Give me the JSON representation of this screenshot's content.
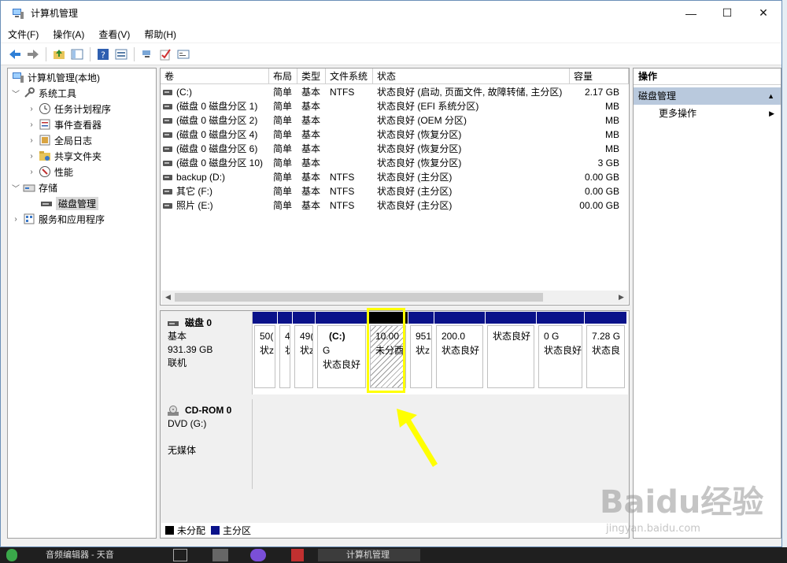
{
  "window": {
    "title": "计算机管理",
    "minimize": "—",
    "maximize": "☐",
    "close": "✕"
  },
  "menu": [
    "文件(F)",
    "操作(A)",
    "查看(V)",
    "帮助(H)"
  ],
  "tree": {
    "root": "计算机管理(本地)",
    "system_tools": "系统工具",
    "task_scheduler": "任务计划程序",
    "event_viewer": "事件查看器",
    "shared_folders_log": "全局日志",
    "shared_folders": "共享文件夹",
    "performance": "性能",
    "storage": "存储",
    "disk_management": "磁盘管理",
    "services": "服务和应用程序"
  },
  "volumes": {
    "headers": [
      "卷",
      "布局",
      "类型",
      "文件系统",
      "状态",
      "容量"
    ],
    "rows": [
      [
        "(C:)",
        "简单",
        "基本",
        "NTFS",
        "状态良好 (启动, 页面文件, 故障转储, 主分区)",
        "2.17 GB"
      ],
      [
        "(磁盘 0 磁盘分区 1)",
        "简单",
        "基本",
        "",
        "状态良好 (EFI 系统分区)",
        "MB"
      ],
      [
        "(磁盘 0 磁盘分区 2)",
        "简单",
        "基本",
        "",
        "状态良好 (OEM 分区)",
        "MB"
      ],
      [
        "(磁盘 0 磁盘分区 4)",
        "简单",
        "基本",
        "",
        "状态良好 (恢复分区)",
        "MB"
      ],
      [
        "(磁盘 0 磁盘分区 6)",
        "简单",
        "基本",
        "",
        "状态良好 (恢复分区)",
        "MB"
      ],
      [
        "(磁盘 0 磁盘分区 10)",
        "简单",
        "基本",
        "",
        "状态良好 (恢复分区)",
        "3 GB"
      ],
      [
        "backup (D:)",
        "简单",
        "基本",
        "NTFS",
        "状态良好 (主分区)",
        "0.00 GB"
      ],
      [
        "其它 (F:)",
        "简单",
        "基本",
        "NTFS",
        "状态良好 (主分区)",
        "0.00 GB"
      ],
      [
        "照片 (E:)",
        "简单",
        "基本",
        "NTFS",
        "状态良好 (主分区)",
        "00.00 GB"
      ]
    ]
  },
  "disk0": {
    "name": "磁盘 0",
    "type": "基本",
    "size": "931.39 GB",
    "status": "联机",
    "partitions": [
      {
        "l1": "50(",
        "l2": "状z"
      },
      {
        "l1": "4",
        "l2": "状"
      },
      {
        "l1": "49(",
        "l2": "状z"
      },
      {
        "l1": "(C:)",
        "l2": "G",
        "l3": "状态良好"
      },
      {
        "l1": "10.00",
        "l2": "未分酉"
      },
      {
        "l1": "951",
        "l2": "状z"
      },
      {
        "l1": "200.0",
        "l2": "状态良好"
      },
      {
        "l1": "",
        "l2": "状态良好"
      },
      {
        "l1": "0 G",
        "l2": "状态良好"
      },
      {
        "l1": "7.28 G",
        "l2": "状态良"
      }
    ]
  },
  "cdrom": {
    "name": "CD-ROM 0",
    "type": "DVD (G:)",
    "status": "无媒体"
  },
  "legend": {
    "unallocated": "未分配",
    "primary": "主分区"
  },
  "actions": {
    "header": "操作",
    "section": "磁盘管理",
    "more": "更多操作"
  },
  "taskbar": {
    "item1": "音频编辑器 - 天音",
    "item2": "计算机管理"
  },
  "watermark": {
    "text": "Baidu经验",
    "url": "jingyan.baidu.com"
  }
}
